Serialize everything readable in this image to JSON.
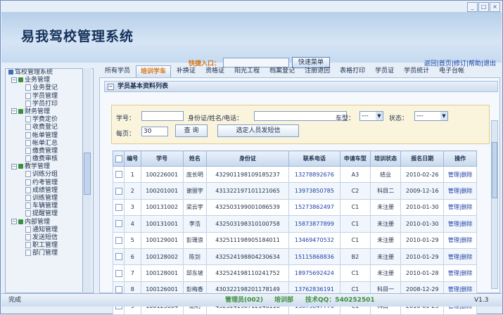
{
  "app": {
    "title": "易我驾校管理系统"
  },
  "quick": {
    "label": "快捷入口：",
    "value": "",
    "button": "快速菜单"
  },
  "toplinks": "返回|首页|修订|帮助|退出",
  "sidebar": {
    "items": [
      {
        "type": "root",
        "label": "驾校管理系统"
      },
      {
        "type": "group",
        "label": "业务管理"
      },
      {
        "type": "leaf",
        "label": "业务登记"
      },
      {
        "type": "leaf",
        "label": "学员管理"
      },
      {
        "type": "leaf",
        "label": "学员打印"
      },
      {
        "type": "group",
        "label": "财务管理"
      },
      {
        "type": "leaf",
        "label": "学费定价"
      },
      {
        "type": "leaf",
        "label": "收费登记"
      },
      {
        "type": "leaf",
        "label": "帐单管理"
      },
      {
        "type": "leaf",
        "label": "帐单汇总"
      },
      {
        "type": "leaf",
        "label": "缴费管理"
      },
      {
        "type": "leaf",
        "label": "缴费审核"
      },
      {
        "type": "group",
        "label": "教学管理"
      },
      {
        "type": "leaf",
        "label": "训练分组"
      },
      {
        "type": "leaf",
        "label": "约考管理"
      },
      {
        "type": "leaf",
        "label": "成绩管理"
      },
      {
        "type": "leaf",
        "label": "训练管理"
      },
      {
        "type": "leaf",
        "label": "车辆管理"
      },
      {
        "type": "leaf",
        "label": "提醒管理"
      },
      {
        "type": "group",
        "label": "内部管理"
      },
      {
        "type": "leaf",
        "label": "通知管理"
      },
      {
        "type": "leaf",
        "label": "发送短信"
      },
      {
        "type": "leaf",
        "label": "职工管理"
      },
      {
        "type": "leaf",
        "label": "部门管理"
      }
    ]
  },
  "tabs": [
    "所有学员",
    "培训学车",
    "补换证",
    "资格证",
    "阳光工程",
    "档案登记",
    "注册退回",
    "表格打印",
    "学员证",
    "学员统计",
    "电子台帐"
  ],
  "panel": {
    "title": "学员基本资料列表"
  },
  "search": {
    "student_no_label": "学号：",
    "id_label": "身份证/姓名/电话：",
    "car_type_label": "车型：",
    "car_type_value": "---",
    "status_label": "状态：",
    "status_value": "---",
    "per_page_label": "每页：",
    "per_page_value": "30",
    "query_button": "查 询",
    "sms_button": "选定人员发短信"
  },
  "table": {
    "headers": [
      "",
      "编号",
      "学号",
      "姓名",
      "身份证",
      "联系电话",
      "申请车型",
      "培训状态",
      "报名日期",
      "操作"
    ],
    "rows": [
      {
        "no": "1",
        "sid": "100226001",
        "name": "庞长明",
        "idcard": "432901198109185237",
        "phone": "13278892676",
        "car": "A3",
        "status": "结业",
        "date": "2010-02-26"
      },
      {
        "no": "2",
        "sid": "100201001",
        "name": "谢丽宇",
        "idcard": "431322197101121065",
        "phone": "13973850785",
        "car": "C2",
        "status": "科目二",
        "date": "2009-12-16"
      },
      {
        "no": "3",
        "sid": "100131002",
        "name": "梁云宇",
        "idcard": "432503199001086539",
        "phone": "15273862497",
        "car": "C1",
        "status": "未注册",
        "date": "2010-01-30"
      },
      {
        "no": "4",
        "sid": "100131001",
        "name": "李浩",
        "idcard": "432503198310100758",
        "phone": "15873877899",
        "car": "C1",
        "status": "未注册",
        "date": "2010-01-30"
      },
      {
        "no": "5",
        "sid": "100129001",
        "name": "彭珊浪",
        "idcard": "432511198905184011",
        "phone": "13469470532",
        "car": "C1",
        "status": "未注册",
        "date": "2010-01-29"
      },
      {
        "no": "6",
        "sid": "100128002",
        "name": "陈剑",
        "idcard": "432524198804230634",
        "phone": "15115868836",
        "car": "B2",
        "status": "未注册",
        "date": "2010-01-29"
      },
      {
        "no": "7",
        "sid": "100128001",
        "name": "邱东坡",
        "idcard": "432524198110241752",
        "phone": "18975692424",
        "car": "C1",
        "status": "未注册",
        "date": "2010-01-28"
      },
      {
        "no": "8",
        "sid": "100126001",
        "name": "彭梅香",
        "idcard": "430322198201178149",
        "phone": "13762836191",
        "car": "C1",
        "status": "科目一",
        "date": "2008-12-29"
      },
      {
        "no": "9",
        "sid": "100125004",
        "name": "胡明",
        "idcard": "432524198712146110",
        "phone": "13873847776",
        "car": "C1",
        "status": "科目一",
        "date": "2010-01-25"
      }
    ],
    "op_edit": "管理",
    "op_delete": "删除"
  },
  "status": {
    "left": "完成",
    "user": "管理员(002)",
    "dept": "培训部",
    "support": "技术QQ：540252501",
    "version": "V1.3"
  }
}
